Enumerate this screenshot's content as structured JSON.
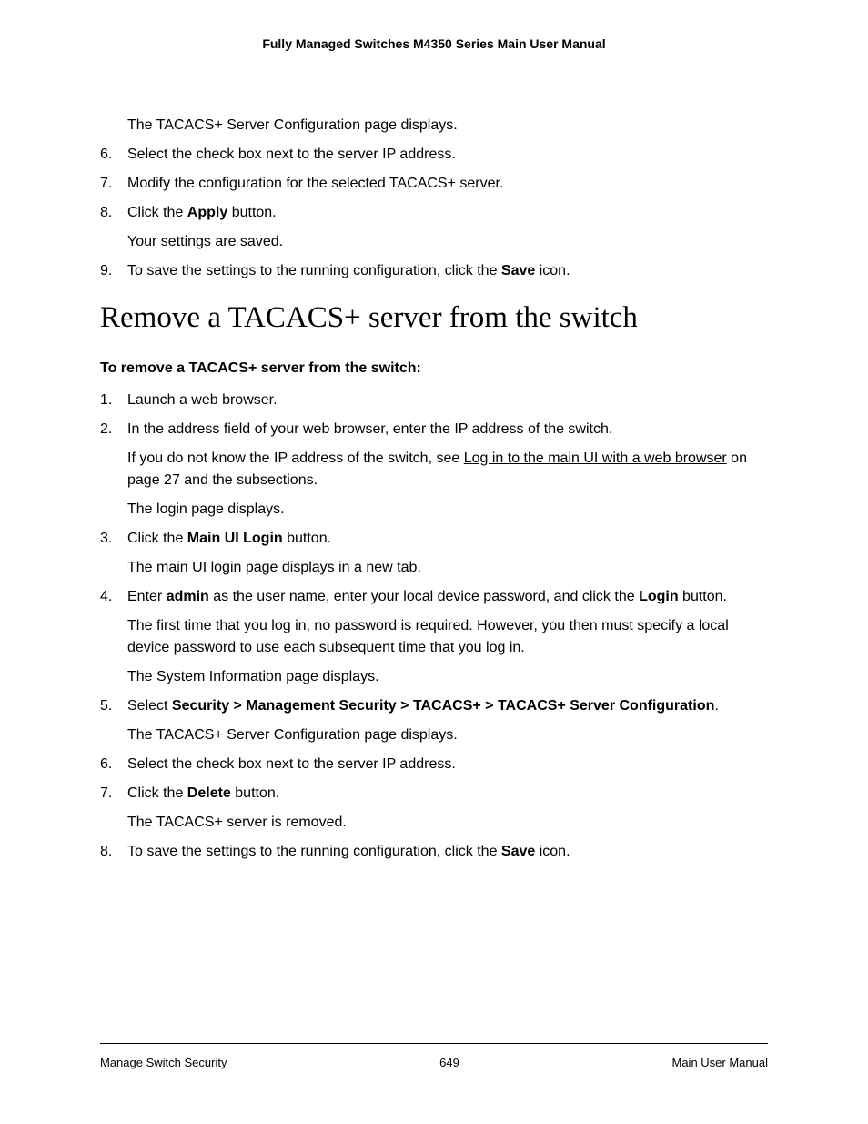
{
  "header": {
    "title": "Fully Managed Switches M4350 Series Main User Manual"
  },
  "block1": {
    "intro": "The TACACS+ Server Configuration page displays.",
    "items": [
      {
        "num": "6.",
        "paras": [
          [
            {
              "t": "Select the check box next to the server IP address."
            }
          ]
        ]
      },
      {
        "num": "7.",
        "paras": [
          [
            {
              "t": "Modify the configuration for the selected TACACS+ server."
            }
          ]
        ]
      },
      {
        "num": "8.",
        "paras": [
          [
            {
              "t": "Click the "
            },
            {
              "t": "Apply",
              "b": true
            },
            {
              "t": " button."
            }
          ],
          [
            {
              "t": "Your settings are saved."
            }
          ]
        ]
      },
      {
        "num": "9.",
        "paras": [
          [
            {
              "t": "To save the settings to the running configuration, click the "
            },
            {
              "t": "Save",
              "b": true
            },
            {
              "t": " icon."
            }
          ]
        ]
      }
    ]
  },
  "section": {
    "heading": "Remove a TACACS+ server from the switch",
    "subheading": "To remove a TACACS+ server from the switch:",
    "items": [
      {
        "num": "1.",
        "paras": [
          [
            {
              "t": "Launch a web browser."
            }
          ]
        ]
      },
      {
        "num": "2.",
        "paras": [
          [
            {
              "t": "In the address field of your web browser, enter the IP address of the switch."
            }
          ],
          [
            {
              "t": "If you do not know the IP address of the switch, see "
            },
            {
              "t": "Log in to the main UI with a web browser",
              "u": true
            },
            {
              "t": " on page 27 and the subsections."
            }
          ],
          [
            {
              "t": "The login page displays."
            }
          ]
        ]
      },
      {
        "num": "3.",
        "paras": [
          [
            {
              "t": "Click the "
            },
            {
              "t": "Main UI Login",
              "b": true
            },
            {
              "t": " button."
            }
          ],
          [
            {
              "t": "The main UI login page displays in a new tab."
            }
          ]
        ]
      },
      {
        "num": "4.",
        "paras": [
          [
            {
              "t": "Enter "
            },
            {
              "t": "admin",
              "b": true
            },
            {
              "t": " as the user name, enter your local device password, and click the "
            },
            {
              "t": "Login",
              "b": true
            },
            {
              "t": " button."
            }
          ],
          [
            {
              "t": "The first time that you log in, no password is required. However, you then must specify a local device password to use each subsequent time that you log in."
            }
          ],
          [
            {
              "t": "The System Information page displays."
            }
          ]
        ]
      },
      {
        "num": "5.",
        "paras": [
          [
            {
              "t": "Select "
            },
            {
              "t": "Security > Management Security > TACACS+ > TACACS+ Server Configuration",
              "b": true
            },
            {
              "t": "."
            }
          ],
          [
            {
              "t": "The TACACS+ Server Configuration page displays."
            }
          ]
        ]
      },
      {
        "num": "6.",
        "paras": [
          [
            {
              "t": "Select the check box next to the server IP address."
            }
          ]
        ]
      },
      {
        "num": "7.",
        "paras": [
          [
            {
              "t": "Click the "
            },
            {
              "t": "Delete",
              "b": true
            },
            {
              "t": " button."
            }
          ],
          [
            {
              "t": "The TACACS+ server is removed."
            }
          ]
        ]
      },
      {
        "num": "8.",
        "paras": [
          [
            {
              "t": "To save the settings to the running configuration, click the "
            },
            {
              "t": "Save",
              "b": true
            },
            {
              "t": " icon."
            }
          ]
        ]
      }
    ]
  },
  "footer": {
    "left": "Manage Switch Security",
    "center": "649",
    "right": "Main User Manual"
  }
}
